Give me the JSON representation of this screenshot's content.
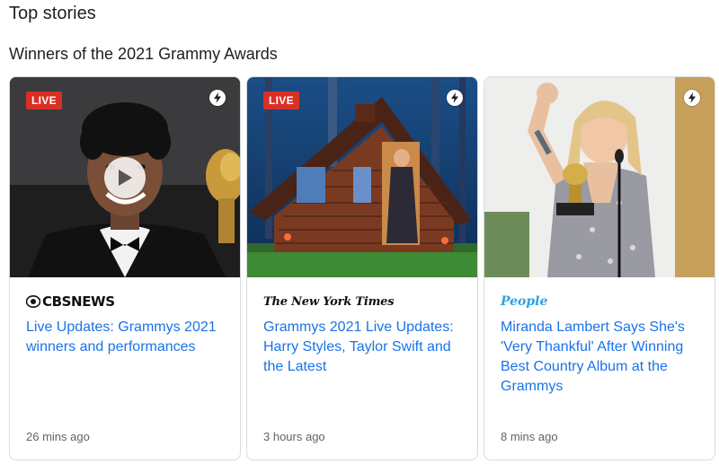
{
  "header": {
    "section_title": "Top stories",
    "subsection_title": "Winners of the 2021 Grammy Awards"
  },
  "cards": [
    {
      "badge": "LIVE",
      "source": "CBSNEWS",
      "headline": "Live Updates: Grammys 2021 winners and performances",
      "time": "26 mins ago",
      "has_video": true,
      "image": "Trevor Noah in tuxedo with Grammy trophy"
    },
    {
      "badge": "LIVE",
      "source": "The New York Times",
      "headline": "Grammys 2021 Live Updates: Harry Styles, Taylor Swift and the Latest",
      "time": "3 hours ago",
      "has_video": false,
      "image": "Singer performing in a cabin in the woods"
    },
    {
      "badge": "",
      "source": "People",
      "headline": "Miranda Lambert Says She's 'Very Thankful' After Winning Best Country Album at the Grammys",
      "time": "8 mins ago",
      "has_video": false,
      "image": "Miranda Lambert holding Grammy with raised fist"
    }
  ],
  "colors": {
    "live_badge": "#d93025",
    "headline_link": "#1a73e8",
    "people_brand": "#2aa5e0",
    "timestamp": "#5f6368"
  },
  "icons": {
    "amp": "lightning-bolt-icon",
    "play": "play-icon"
  }
}
